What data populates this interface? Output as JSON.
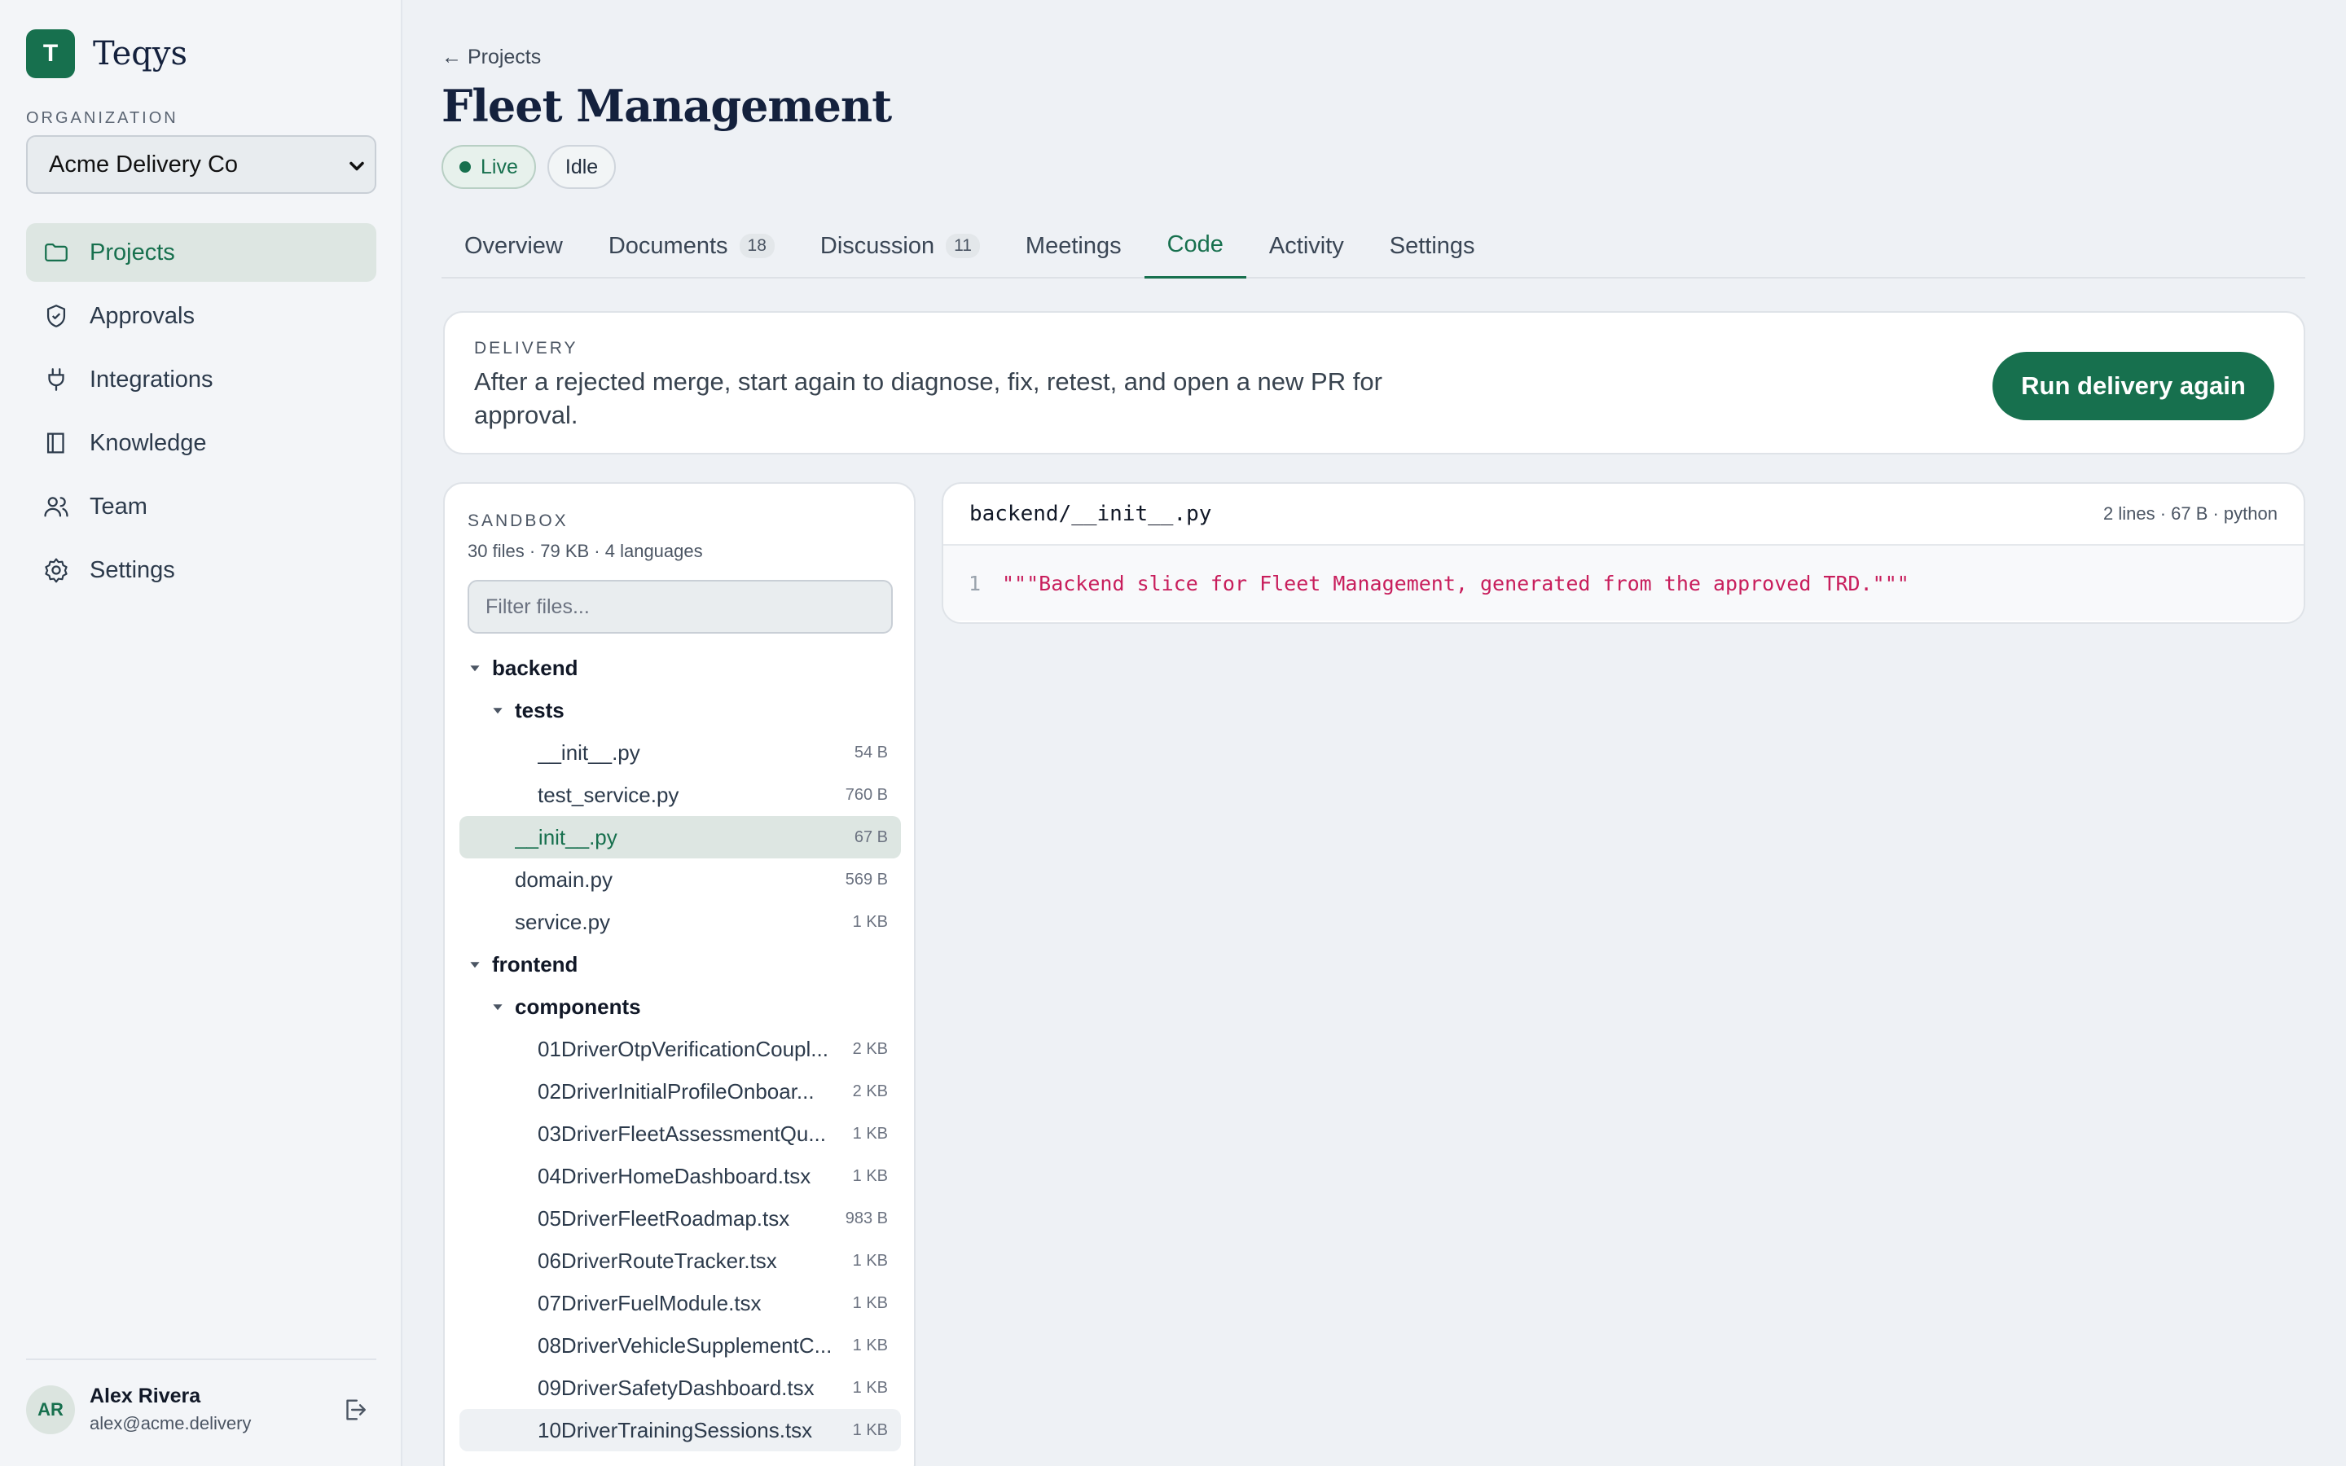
{
  "app": {
    "logo_letter": "T",
    "name": "Teqys"
  },
  "sidebar": {
    "org_label": "ORGANIZATION",
    "org_value": "Acme Delivery Co",
    "items": [
      {
        "label": "Projects",
        "icon": "folder-icon",
        "active": true
      },
      {
        "label": "Approvals",
        "icon": "shield-check-icon"
      },
      {
        "label": "Integrations",
        "icon": "plug-icon"
      },
      {
        "label": "Knowledge",
        "icon": "book-icon"
      },
      {
        "label": "Team",
        "icon": "users-icon"
      },
      {
        "label": "Settings",
        "icon": "gear-icon"
      }
    ],
    "user": {
      "initials": "AR",
      "name": "Alex Rivera",
      "email": "alex@acme.delivery"
    }
  },
  "header": {
    "back_label": "← Projects",
    "title": "Fleet Management",
    "badges": {
      "live": "Live",
      "idle": "Idle"
    }
  },
  "tabs": [
    {
      "label": "Overview"
    },
    {
      "label": "Documents",
      "count": "18"
    },
    {
      "label": "Discussion",
      "count": "11"
    },
    {
      "label": "Meetings"
    },
    {
      "label": "Code",
      "active": true
    },
    {
      "label": "Activity"
    },
    {
      "label": "Settings"
    }
  ],
  "delivery": {
    "label": "DELIVERY",
    "text": "After a rejected merge, start again to diagnose, fix, retest, and open a new PR for approval.",
    "button": "Run delivery again"
  },
  "sandbox": {
    "label": "SANDBOX",
    "meta": "30 files · 79 KB · 4 languages",
    "filter_placeholder": "Filter files...",
    "tree": {
      "backend": "backend",
      "tests": "tests",
      "tests_init": {
        "name": "__init__.py",
        "size": "54 B"
      },
      "test_service": {
        "name": "test_service.py",
        "size": "760 B"
      },
      "backend_init": {
        "name": "__init__.py",
        "size": "67 B"
      },
      "domain": {
        "name": "domain.py",
        "size": "569 B"
      },
      "service": {
        "name": "service.py",
        "size": "1 KB"
      },
      "frontend": "frontend",
      "components": "components",
      "files": [
        {
          "name": "01DriverOtpVerificationCoupl...",
          "size": "2 KB"
        },
        {
          "name": "02DriverInitialProfileOnboar...",
          "size": "2 KB"
        },
        {
          "name": "03DriverFleetAssessmentQu...",
          "size": "1 KB"
        },
        {
          "name": "04DriverHomeDashboard.tsx",
          "size": "1 KB"
        },
        {
          "name": "05DriverFleetRoadmap.tsx",
          "size": "983 B"
        },
        {
          "name": "06DriverRouteTracker.tsx",
          "size": "1 KB"
        },
        {
          "name": "07DriverFuelModule.tsx",
          "size": "1 KB"
        },
        {
          "name": "08DriverVehicleSupplementC...",
          "size": "1 KB"
        },
        {
          "name": "09DriverSafetyDashboard.tsx",
          "size": "1 KB"
        },
        {
          "name": "10DriverTrainingSessions.tsx",
          "size": "1 KB"
        }
      ]
    }
  },
  "viewer": {
    "path": "backend/__init__.py",
    "meta": "2 lines · 67 B · python",
    "line_number": "1",
    "code": "\"\"\"Backend slice for Fleet Management, generated from the approved TRD.\"\"\""
  }
}
